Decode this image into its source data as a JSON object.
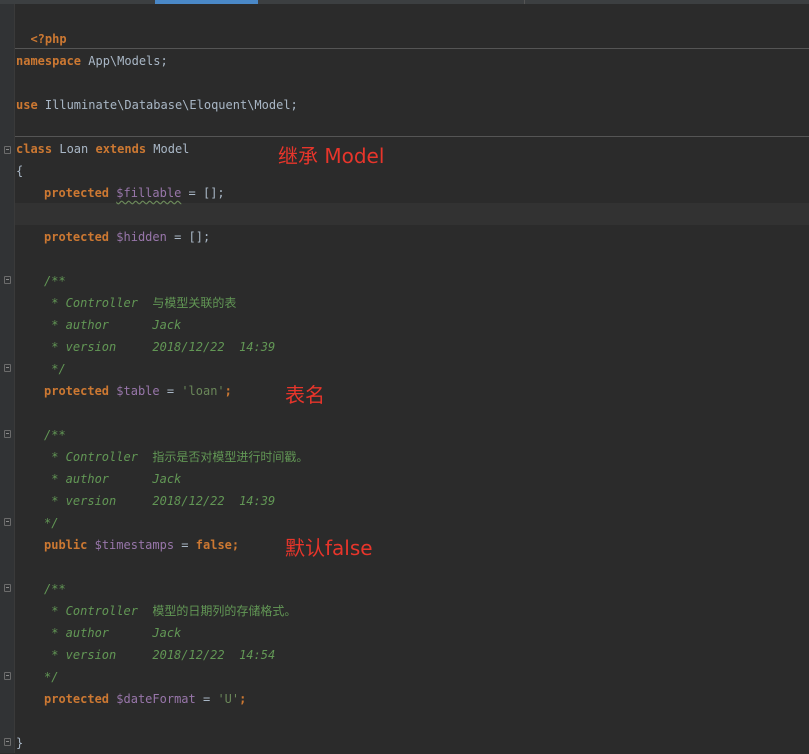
{
  "editor": {
    "lines": {
      "php_open": "<?php",
      "namespace_kw": "namespace",
      "namespace_name": " App\\Models;",
      "use_kw": "use",
      "use_name": " Illuminate\\Database\\Eloquent\\Model;",
      "class_kw": "class",
      "class_name": " Loan ",
      "extends_kw": "extends",
      "parent_name": " Model",
      "brace_open": "{",
      "prot1_kw": "protected",
      "fillable_var": "$fillable",
      "fillable_rest": " = [];",
      "prot2_kw": "protected",
      "hidden_var": "$hidden",
      "hidden_rest": " = [];",
      "doc1_open": "/**",
      "doc1_controller": " * Controller  ",
      "doc1_controller_desc": "与模型关联的表",
      "doc1_author": " * author      Jack",
      "doc1_version": " * version     2018/12/22  14:39",
      "doc1_close": " */",
      "prot3_kw": "protected",
      "table_var": "$table",
      "table_eq": " = ",
      "table_str": "'loan'",
      "table_end": ";",
      "doc2_open": "/**",
      "doc2_controller": " * Controller  ",
      "doc2_controller_desc": "指示是否对模型进行时间戳。",
      "doc2_author": " * author      Jack",
      "doc2_version": " * version     2018/12/22  14:39",
      "doc2_close": "*/",
      "public_kw": "public",
      "timestamps_var": "$timestamps",
      "timestamps_eq": " = ",
      "false_kw": "false",
      "timestamps_end": ";",
      "doc3_open": "/**",
      "doc3_controller": " * Controller  ",
      "doc3_controller_desc": "模型的日期列的存储格式。",
      "doc3_author": " * author      Jack",
      "doc3_version": " * version     2018/12/22  14:54",
      "doc3_close": "*/",
      "prot4_kw": "protected",
      "dateformat_var": "$dateFormat",
      "dateformat_eq": " = ",
      "dateformat_str": "'U'",
      "dateformat_end": ";",
      "brace_close": "}"
    }
  },
  "annotations": {
    "extends_note": "继承 Model",
    "table_note": "表名",
    "timestamps_note": "默认false"
  },
  "colors": {
    "background": "#2b2b2b",
    "keyword": "#cc7832",
    "variable": "#9876aa",
    "string": "#6a8759",
    "comment": "#629755",
    "annotation": "#e8352b"
  }
}
